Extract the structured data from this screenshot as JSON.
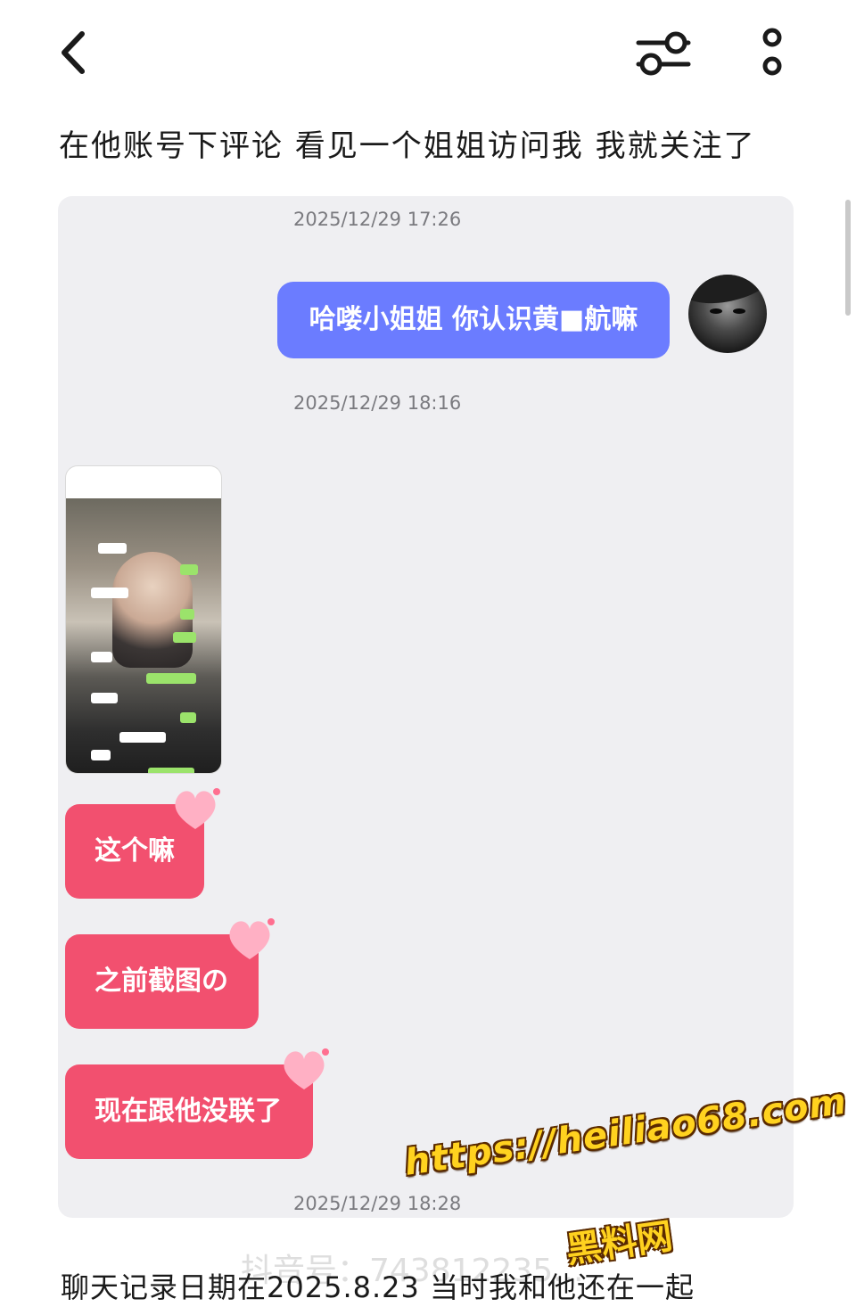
{
  "post": {
    "title": "在他账号下评论 看见一个姐姐访问我 我就关注了",
    "caption": "聊天记录日期在2025.8.23 当时我和他还在一起"
  },
  "chat": {
    "messages": [
      {
        "type": "timestamp",
        "text": "2025/12/29 17:26"
      },
      {
        "type": "sent",
        "text": "哈喽小姐姐 你认识黄■航嘛"
      },
      {
        "type": "timestamp",
        "text": "2025/12/29 18:16"
      },
      {
        "type": "image",
        "description": "screenshot-thumbnail"
      },
      {
        "type": "received",
        "text": "这个嘛"
      },
      {
        "type": "received",
        "text": "之前截图の"
      },
      {
        "type": "received",
        "text": "现在跟他没联了"
      },
      {
        "type": "timestamp",
        "text": "2025/12/29 18:28"
      }
    ]
  },
  "watermark": {
    "url": "https://heiliao68.com",
    "site": "黑料网",
    "faint_id": "抖音号：743812235..."
  },
  "colors": {
    "sent_bubble": "#6b7cff",
    "received_bubble": "#f2506f",
    "chat_bg": "#efeff2",
    "watermark": "#ffd21f"
  },
  "icons": {
    "back": "chevron-left-icon",
    "filter": "sliders-icon",
    "more": "more-vertical-icon"
  }
}
